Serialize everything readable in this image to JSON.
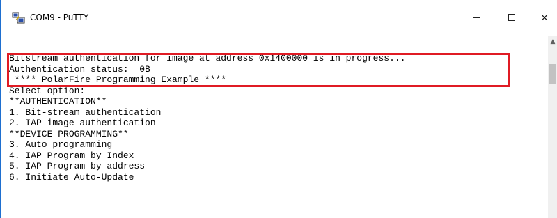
{
  "window": {
    "title": "COM9 - PuTTY",
    "controls": {
      "minimize": "minimize",
      "maximize": "maximize",
      "close": "×"
    }
  },
  "terminal": {
    "lines": [
      "Bitstream authentication for image at address 0x1400000 is in progress...",
      "Authentication status:  0B",
      " **** PolarFire Programming Example ****",
      "Select option:",
      "**AUTHENTICATION**",
      "1. Bit-stream authentication",
      "2. IAP image authentication",
      "**DEVICE PROGRAMMING**",
      "3. Auto programming",
      "4. IAP Program by Index",
      "5. IAP Program by address",
      "6. Initiate Auto-Update"
    ]
  },
  "highlight": {
    "color": "#e01b24",
    "covers_lines": [
      0,
      1
    ]
  },
  "colors": {
    "window_border": "#1e6fd0",
    "terminal_background": "#ffffff",
    "terminal_text": "#000000"
  },
  "icons": {
    "app": "putty-icon",
    "scroll_up": "chevron-up-icon"
  }
}
